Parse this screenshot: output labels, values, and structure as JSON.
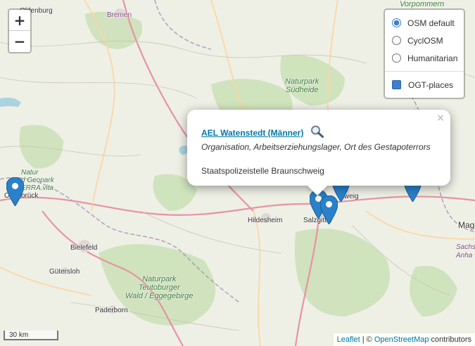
{
  "map": {
    "places": [
      {
        "id": "oldenburg",
        "text": "Oldenburg"
      },
      {
        "id": "bremen",
        "text": "Bremen"
      },
      {
        "id": "suedheide",
        "text": "Naturpark\nSüdheide"
      },
      {
        "id": "vorpommern",
        "text": "Vorpommern"
      },
      {
        "id": "geopark",
        "text": "Natur\nd Geopark\nERRA.vita"
      },
      {
        "id": "osnabrueck",
        "text": "Osnabrück"
      },
      {
        "id": "hildesheim",
        "text": "Hildesheim"
      },
      {
        "id": "salzgitter",
        "text": "Salzgitter"
      },
      {
        "id": "braunschweig",
        "text": "weig"
      },
      {
        "id": "magdeburg",
        "text": "Mag"
      },
      {
        "id": "sachsen",
        "text": "Sachs\nAnha"
      },
      {
        "id": "bielefeld",
        "text": "Bielefeld"
      },
      {
        "id": "guetersloh",
        "text": "Gütersloh"
      },
      {
        "id": "teutoburger",
        "text": "Naturpark\nTeutoburger\nWald / Eggegebirge"
      },
      {
        "id": "paderborn",
        "text": "Paderborn"
      }
    ]
  },
  "zoom": {
    "in_label": "+",
    "out_label": "−"
  },
  "layers": {
    "base": [
      {
        "label": "OSM default",
        "selected": true
      },
      {
        "label": "CyclOSM",
        "selected": false
      },
      {
        "label": "Humanitarian",
        "selected": false
      }
    ],
    "overlays": [
      {
        "label": "OGT-places",
        "checked": true
      }
    ]
  },
  "popup": {
    "close": "×",
    "title": "AEL Watenstedt (Männer)",
    "categories": "Organisation, Arbeitserziehungslager, Ort des Gestapoterrors",
    "description": "Staatspolizeistelle Braunschweig"
  },
  "scale": {
    "label": "30 km"
  },
  "attribution": {
    "leaflet": "Leaflet",
    "separator": " | © ",
    "osm": "OpenStreetMap",
    "suffix": " contributors"
  },
  "colors": {
    "marker": "#2a81cb",
    "link": "#0078a8",
    "checkbox": "#3b7fd0"
  },
  "icons": {
    "search": "magnifier-icon",
    "marker": "map-pin-icon"
  }
}
